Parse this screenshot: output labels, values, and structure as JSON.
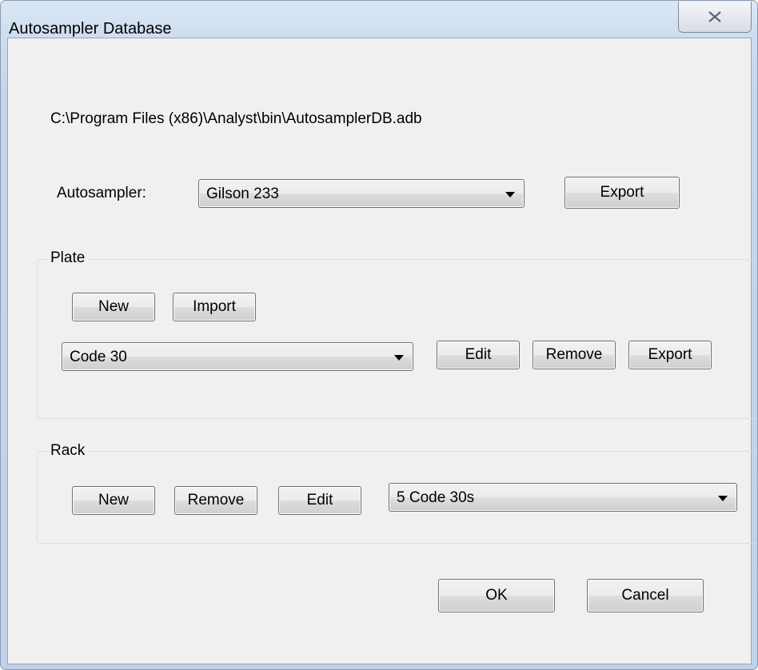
{
  "window": {
    "title": "Autosampler Database",
    "close_glyph": "☒"
  },
  "file_path": "C:\\Program Files (x86)\\Analyst\\bin\\AutosamplerDB.adb",
  "autosampler": {
    "label": "Autosampler:",
    "selected": "Gilson 233",
    "export_label": "Export"
  },
  "plate": {
    "title": "Plate",
    "new_label": "New",
    "import_label": "Import",
    "selected": "Code 30",
    "edit_label": "Edit",
    "remove_label": "Remove",
    "export_label": "Export"
  },
  "rack": {
    "title": "Rack",
    "new_label": "New",
    "remove_label": "Remove",
    "edit_label": "Edit",
    "selected": "5 Code 30s"
  },
  "footer": {
    "ok_label": "OK",
    "cancel_label": "Cancel"
  }
}
